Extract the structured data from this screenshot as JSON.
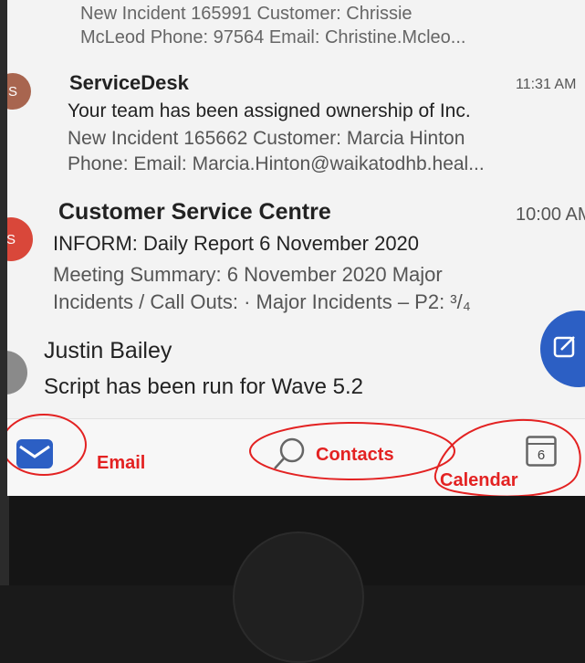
{
  "emails": [
    {
      "sender": "",
      "time": "",
      "avatar": "",
      "lines": [
        "New Incident 165991 Customer: Chrissie",
        "McLeod Phone: 97564 Email: Christine.Mcleo..."
      ]
    },
    {
      "sender": "ServiceDesk",
      "time": "11:31 AM",
      "avatar": "S",
      "avatar_color": "#a8654f",
      "lines": [
        "Your team has been assigned ownership of Inc.",
        "New Incident 165662 Customer: Marcia Hinton",
        "Phone: Email: Marcia.Hinton@waikatodhb.heal..."
      ]
    },
    {
      "sender": "Customer Service Centre",
      "time": "10:00 AM",
      "avatar": "S",
      "avatar_color": "#d9473a",
      "lines": [
        "INFORM: Daily Report 6 November 2020",
        "Meeting Summary: 6 November 2020 Major",
        "Incidents / Call Outs: · Major Incidents – P2: ³/₄"
      ]
    },
    {
      "sender": "Justin Bailey",
      "time": "",
      "avatar": "",
      "avatar_color": "#8a8a8a",
      "lines": [
        "Script has been run for Wave 5.2"
      ]
    }
  ],
  "compose_icon": "compose-icon",
  "tabs": {
    "email": {
      "icon": "mail-icon",
      "color": "#2c5fc4"
    },
    "contacts": {
      "icon": "search-icon"
    },
    "calendar": {
      "icon": "calendar-icon",
      "day": "6"
    }
  },
  "annotations": {
    "email": "Email",
    "contacts": "Contacts",
    "calendar": "Calendar",
    "color": "#e32222"
  }
}
